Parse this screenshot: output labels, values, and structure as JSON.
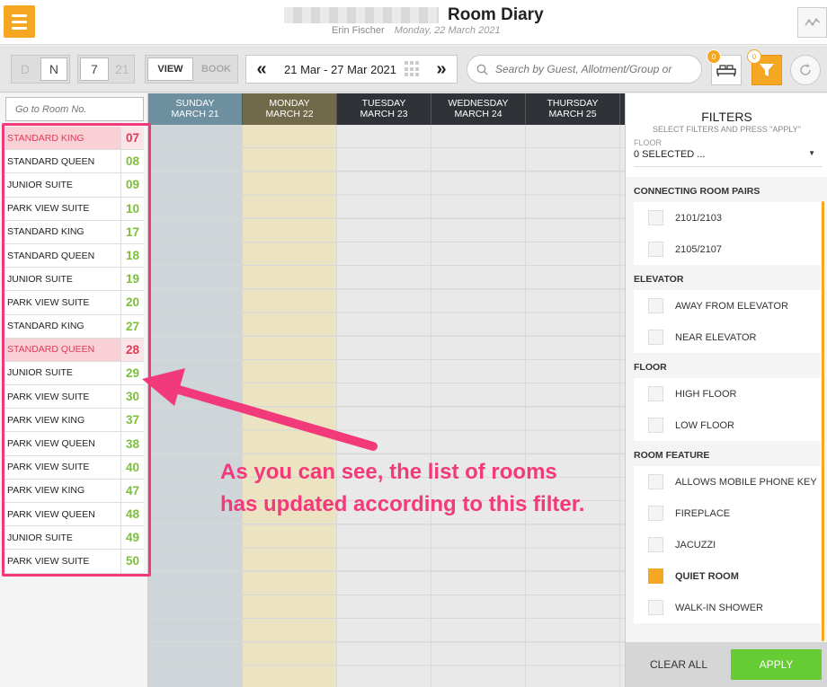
{
  "header": {
    "title": "Room Diary",
    "user": "Erin Fischer",
    "date": "Monday, 22 March 2021"
  },
  "toolbar": {
    "mode_d": "D",
    "mode_n": "N",
    "week_7": "7",
    "week_21": "21",
    "view_label": "VIEW",
    "book_label": "BOOK",
    "prev": "«",
    "date_range": "21 Mar - 27 Mar 2021",
    "next": "»",
    "search_placeholder": "Search by Guest, Allotment/Group or",
    "bed_badge": "0",
    "filter_badge": "0"
  },
  "room_list": {
    "goto_placeholder": "Go to Room No.",
    "rooms": [
      {
        "type": "STANDARD KING",
        "number": "07",
        "alert": true
      },
      {
        "type": "STANDARD QUEEN",
        "number": "08",
        "alert": false
      },
      {
        "type": "JUNIOR SUITE",
        "number": "09",
        "alert": false
      },
      {
        "type": "PARK VIEW SUITE",
        "number": "10",
        "alert": false
      },
      {
        "type": "STANDARD KING",
        "number": "17",
        "alert": false
      },
      {
        "type": "STANDARD QUEEN",
        "number": "18",
        "alert": false
      },
      {
        "type": "JUNIOR SUITE",
        "number": "19",
        "alert": false
      },
      {
        "type": "PARK VIEW SUITE",
        "number": "20",
        "alert": false
      },
      {
        "type": "STANDARD KING",
        "number": "27",
        "alert": false
      },
      {
        "type": "STANDARD QUEEN",
        "number": "28",
        "alert": true
      },
      {
        "type": "JUNIOR SUITE",
        "number": "29",
        "alert": false
      },
      {
        "type": "PARK VIEW SUITE",
        "number": "30",
        "alert": false
      },
      {
        "type": "PARK VIEW KING",
        "number": "37",
        "alert": false
      },
      {
        "type": "PARK VIEW QUEEN",
        "number": "38",
        "alert": false
      },
      {
        "type": "PARK VIEW SUITE",
        "number": "40",
        "alert": false
      },
      {
        "type": "PARK VIEW KING",
        "number": "47",
        "alert": false
      },
      {
        "type": "PARK VIEW QUEEN",
        "number": "48",
        "alert": false
      },
      {
        "type": "JUNIOR SUITE",
        "number": "49",
        "alert": false
      },
      {
        "type": "PARK VIEW SUITE",
        "number": "50",
        "alert": false
      }
    ]
  },
  "calendar": {
    "days": [
      {
        "weekday": "SUNDAY",
        "date": "MARCH 21",
        "header_color": "#6e8fa0",
        "column_color": "#cfd6da"
      },
      {
        "weekday": "MONDAY",
        "date": "MARCH 22",
        "header_color": "#706a4a",
        "column_color": "#ebe3c2"
      },
      {
        "weekday": "TUESDAY",
        "date": "MARCH 23",
        "header_color": "#2f3338",
        "column_color": "#e9e9e9"
      },
      {
        "weekday": "WEDNESDAY",
        "date": "MARCH 24",
        "header_color": "#2f3338",
        "column_color": "#e9e9e9"
      },
      {
        "weekday": "THURSDAY",
        "date": "MARCH 25",
        "header_color": "#2f3338",
        "column_color": "#e9e9e9"
      },
      {
        "weekday": "",
        "date": "",
        "header_color": "#2f3338",
        "column_color": "#e9e9e9"
      }
    ]
  },
  "filters": {
    "title": "FILTERS",
    "subtitle": "SELECT FILTERS AND PRESS \"APPLY\"",
    "floor_label": "FLOOR",
    "floor_value": "0 SELECTED ...",
    "sections": [
      {
        "title": "CONNECTING ROOM PAIRS",
        "options": [
          {
            "label": "2101/2103",
            "checked": false
          },
          {
            "label": "2105/2107",
            "checked": false
          }
        ]
      },
      {
        "title": "ELEVATOR",
        "options": [
          {
            "label": "AWAY FROM ELEVATOR",
            "checked": false
          },
          {
            "label": "NEAR ELEVATOR",
            "checked": false
          }
        ]
      },
      {
        "title": "FLOOR",
        "options": [
          {
            "label": "HIGH FLOOR",
            "checked": false
          },
          {
            "label": "LOW FLOOR",
            "checked": false
          }
        ]
      },
      {
        "title": "ROOM FEATURE",
        "options": [
          {
            "label": "ALLOWS MOBILE PHONE KEY",
            "checked": false
          },
          {
            "label": "FIREPLACE",
            "checked": false
          },
          {
            "label": "JACUZZI",
            "checked": false
          },
          {
            "label": "QUIET ROOM",
            "checked": true
          },
          {
            "label": "WALK-IN SHOWER",
            "checked": false
          }
        ]
      }
    ],
    "clear_label": "CLEAR ALL",
    "apply_label": "APPLY"
  },
  "annotation": {
    "line1": "As you can see, the list of rooms",
    "line2": "has updated according to this filter."
  },
  "colors": {
    "accent": "#f5a623",
    "apply_green": "#66cc33",
    "annotation_pink": "#f23a7a",
    "available_green": "#7cbf3a",
    "alert_red": "#e23a55"
  }
}
